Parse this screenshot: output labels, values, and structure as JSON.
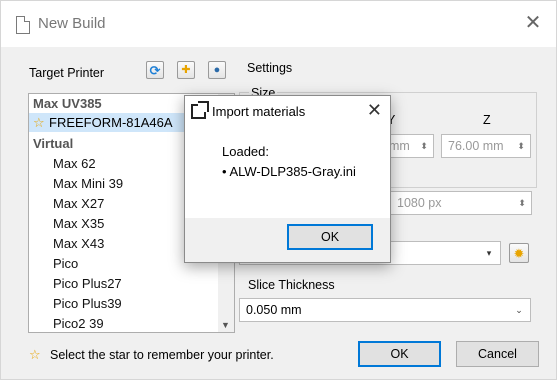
{
  "window": {
    "title": "New Build",
    "close_glyph": "✕",
    "icon": "document-icon"
  },
  "printers": {
    "label": "Target Printer",
    "tools": [
      {
        "name": "refresh-icon",
        "glyph": "⟳",
        "color": "#1d7fd6"
      },
      {
        "name": "add-star-icon",
        "glyph": "✚",
        "color": "#e8a400"
      },
      {
        "name": "network-icon",
        "glyph": "●",
        "color": "#2b6aa8"
      }
    ],
    "groups": [
      {
        "type": "group",
        "label": "Max UV385"
      },
      {
        "type": "selected",
        "label": "FREEFORM-81A46A",
        "star": "☆"
      },
      {
        "type": "group",
        "label": "Virtual"
      },
      {
        "type": "item",
        "label": "Max 62"
      },
      {
        "type": "item",
        "label": "Max Mini 39"
      },
      {
        "type": "item",
        "label": "Max X27"
      },
      {
        "type": "item",
        "label": "Max X35"
      },
      {
        "type": "item",
        "label": "Max X43"
      },
      {
        "type": "item",
        "label": "Pico"
      },
      {
        "type": "item",
        "label": "Pico Plus27"
      },
      {
        "type": "item",
        "label": "Pico Plus39"
      },
      {
        "type": "item",
        "label": "Pico2 39"
      }
    ]
  },
  "settings": {
    "label": "Settings",
    "size_label": "Size",
    "y_label": "Y",
    "z_label": "Z",
    "y_value": "mm",
    "z_value": "76.00 mm",
    "resolution_value": "1080 px",
    "slice_label": "Slice Thickness",
    "slice_value": "0.050 mm"
  },
  "footer": {
    "hint": "Select the star to remember your printer.",
    "ok": "OK",
    "cancel": "Cancel"
  },
  "dialog": {
    "title": "Import materials",
    "close_glyph": "✕",
    "loaded_label": "Loaded:",
    "file": "• ALW-DLP385-Gray.ini",
    "ok": "OK"
  }
}
